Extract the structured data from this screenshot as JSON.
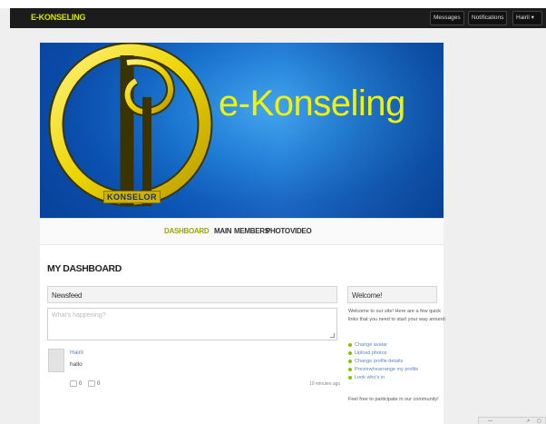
{
  "topbar": {
    "brand": "E-KONSELING",
    "buttons": [
      "Messages",
      "Notifications",
      "Hairil"
    ],
    "dropdown_glyph": "▾"
  },
  "banner": {
    "title": "e-Konseling",
    "logo_label": "KONSELOR",
    "colors": {
      "sky": "#1f82db",
      "deep": "#0a4aa3",
      "ring": "#ecd400",
      "text": "#f1f20a"
    }
  },
  "tabs": [
    {
      "label": "DASHBOARD",
      "active": true
    },
    {
      "label": "MAIN",
      "active": false
    },
    {
      "label": "MEMBERS",
      "active": false
    },
    {
      "label": "PHOTO",
      "active": false
    },
    {
      "label": "VIDEO",
      "active": false
    }
  ],
  "page": {
    "title": "MY DASHBOARD"
  },
  "newsfeed": {
    "heading": "Newsfeed",
    "compose_placeholder": "What's happening?",
    "post": {
      "author": "Hairil",
      "text": "hallo",
      "comments": "0",
      "likes": "0",
      "time": "10 minutes ago"
    }
  },
  "welcome": {
    "heading": "Welcome!",
    "intro": "Welcome to our site! Here are a few quick links that you need to start your way around:",
    "links": [
      "Change avatar",
      "Upload photos",
      "Change profile details",
      "Preview/rearrange my profile",
      "Look who's in"
    ],
    "footer": "Feel free to participate in our community!"
  },
  "icons": {
    "comment": "comment-icon",
    "like": "thumbs-up-icon"
  },
  "accent": "#9ca600"
}
